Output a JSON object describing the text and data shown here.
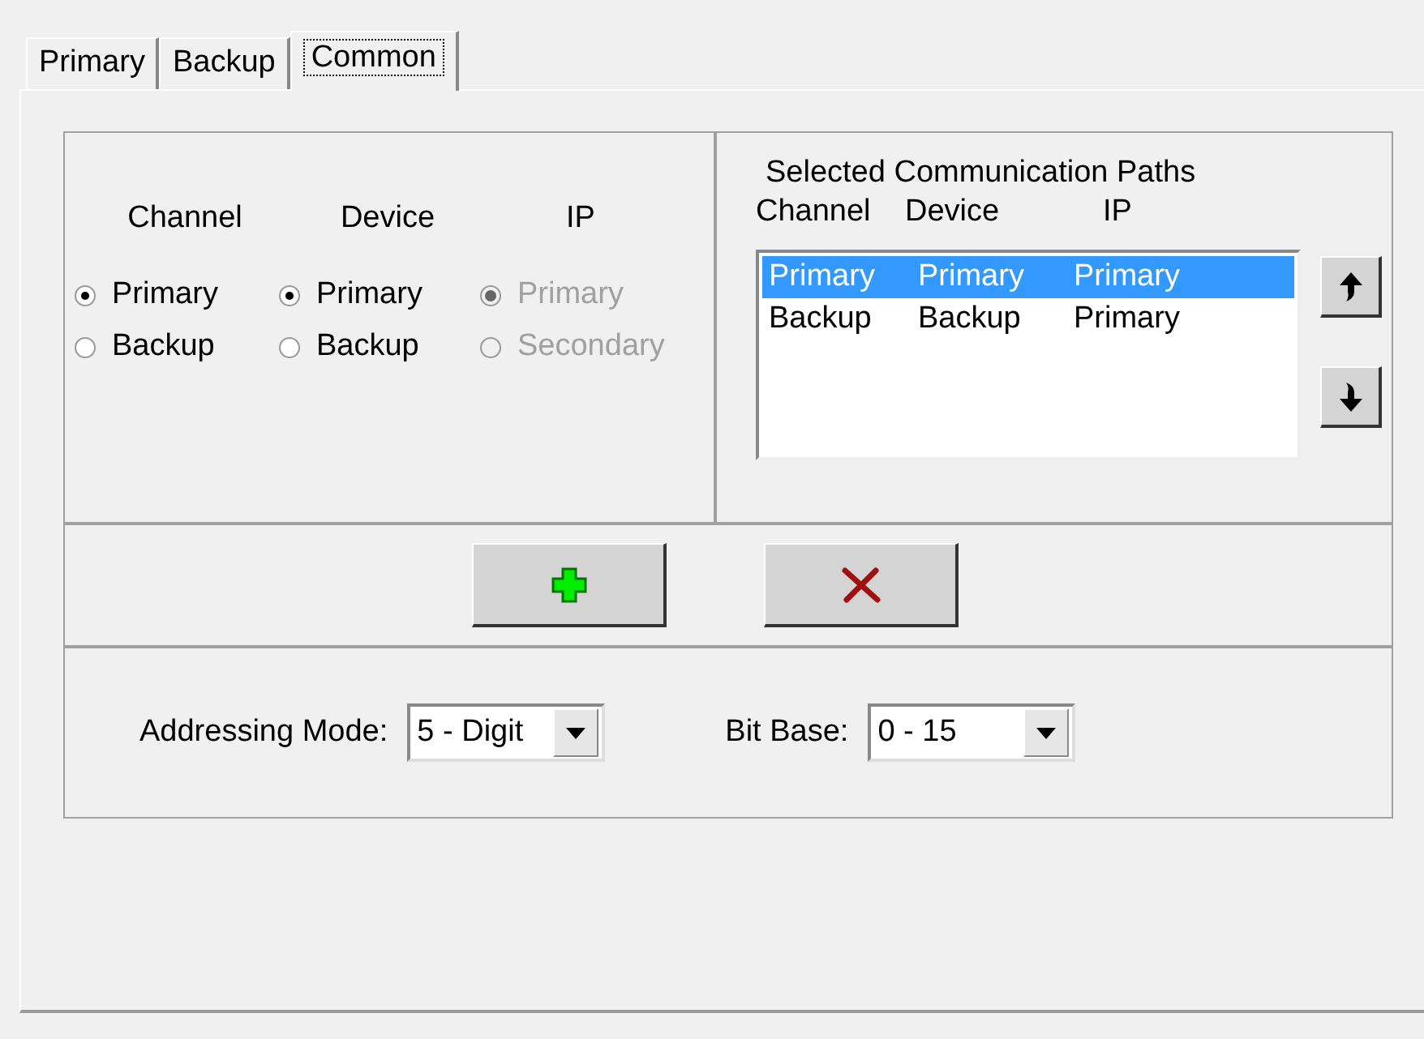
{
  "tabs": [
    {
      "label": "Primary",
      "selected": false
    },
    {
      "label": "Backup",
      "selected": false
    },
    {
      "label": "Common",
      "selected": true
    }
  ],
  "groups": [
    {
      "heading": "Channel",
      "disabled": false,
      "options": [
        {
          "label": "Primary",
          "selected": true
        },
        {
          "label": "Backup",
          "selected": false
        }
      ]
    },
    {
      "heading": "Device",
      "disabled": false,
      "options": [
        {
          "label": "Primary",
          "selected": true
        },
        {
          "label": "Backup",
          "selected": false
        }
      ]
    },
    {
      "heading": "IP",
      "disabled": true,
      "options": [
        {
          "label": "Primary",
          "selected": true
        },
        {
          "label": "Secondary",
          "selected": false
        }
      ]
    }
  ],
  "paths": {
    "title": "Selected Communication Paths",
    "columns": [
      "Channel",
      "Device",
      "IP"
    ],
    "rows": [
      {
        "cells": [
          "Primary",
          "Primary",
          "Primary"
        ],
        "selected": true
      },
      {
        "cells": [
          "Backup",
          "Backup",
          "Primary"
        ],
        "selected": false
      }
    ]
  },
  "addressing_mode": {
    "label": "Addressing Mode:",
    "value": "5 - Digit"
  },
  "bit_base": {
    "label": "Bit Base:",
    "value": "0 - 15"
  }
}
